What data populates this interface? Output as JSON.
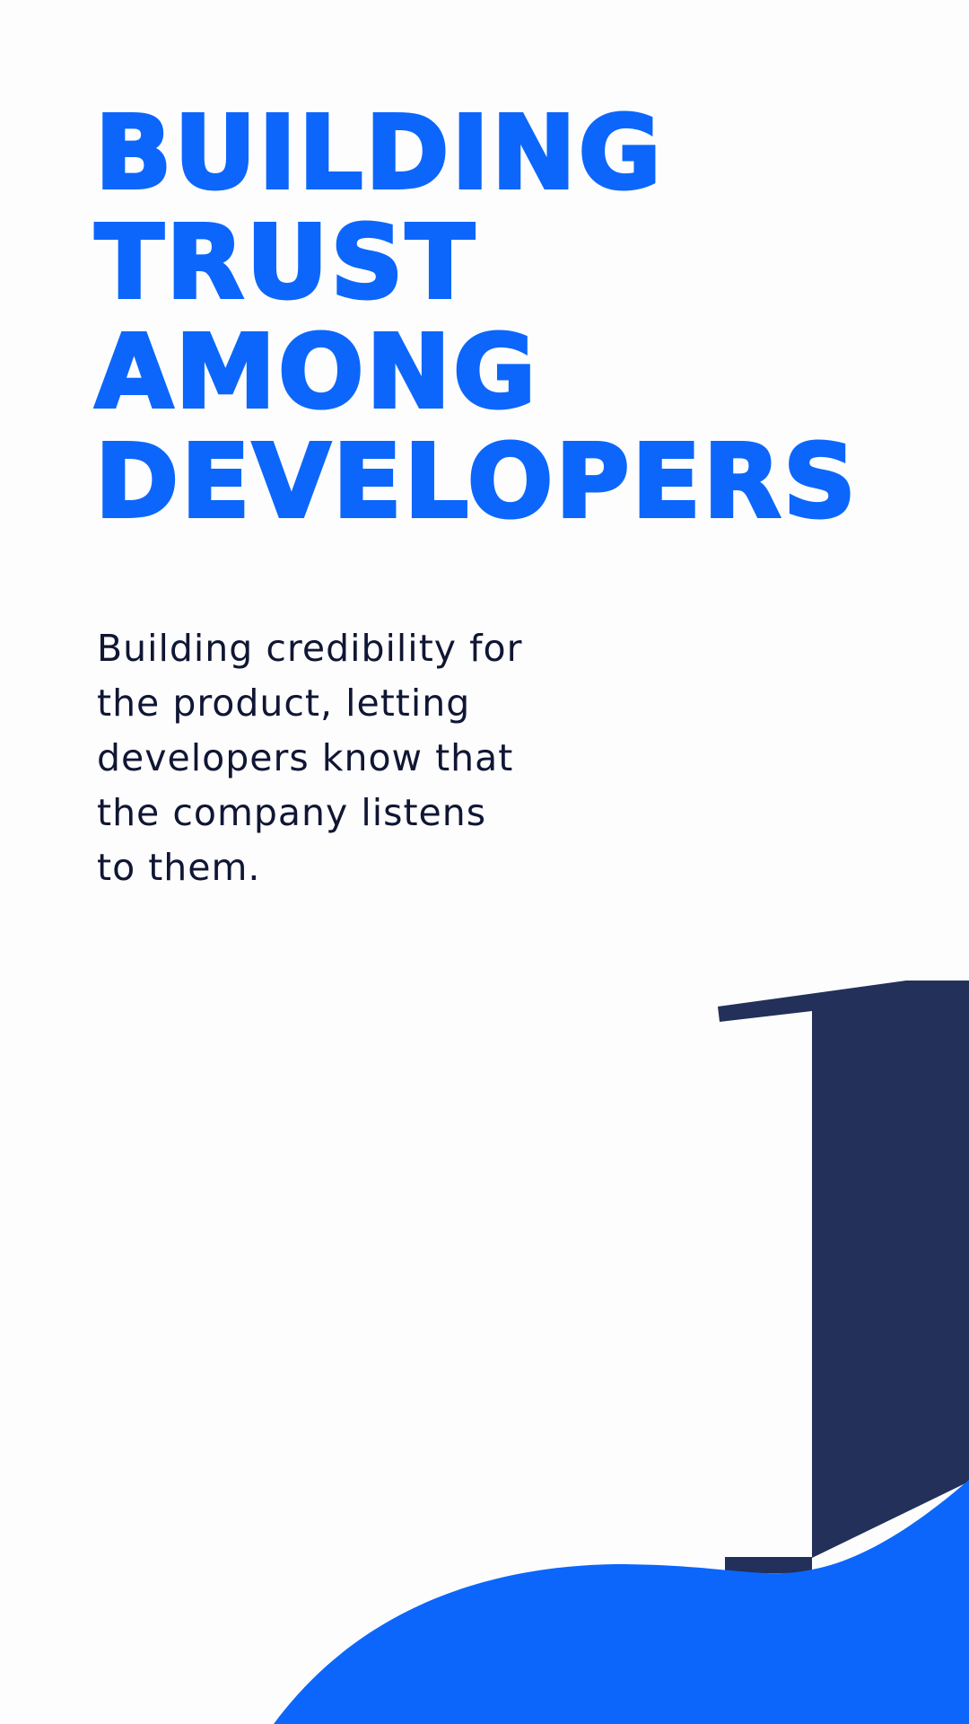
{
  "headline": {
    "lines": [
      "BUILDING",
      "TRUST",
      "AMONG",
      "DEVELOPERS"
    ]
  },
  "body": {
    "lines": [
      "Building credibility for",
      "the product, letting",
      "developers know that",
      "the company listens",
      "to them."
    ]
  },
  "decor": {
    "numeral": "1"
  },
  "colors": {
    "accent": "#0c66fb",
    "navy": "#22305a",
    "text": "#101634",
    "background": "#fdfdfd"
  }
}
